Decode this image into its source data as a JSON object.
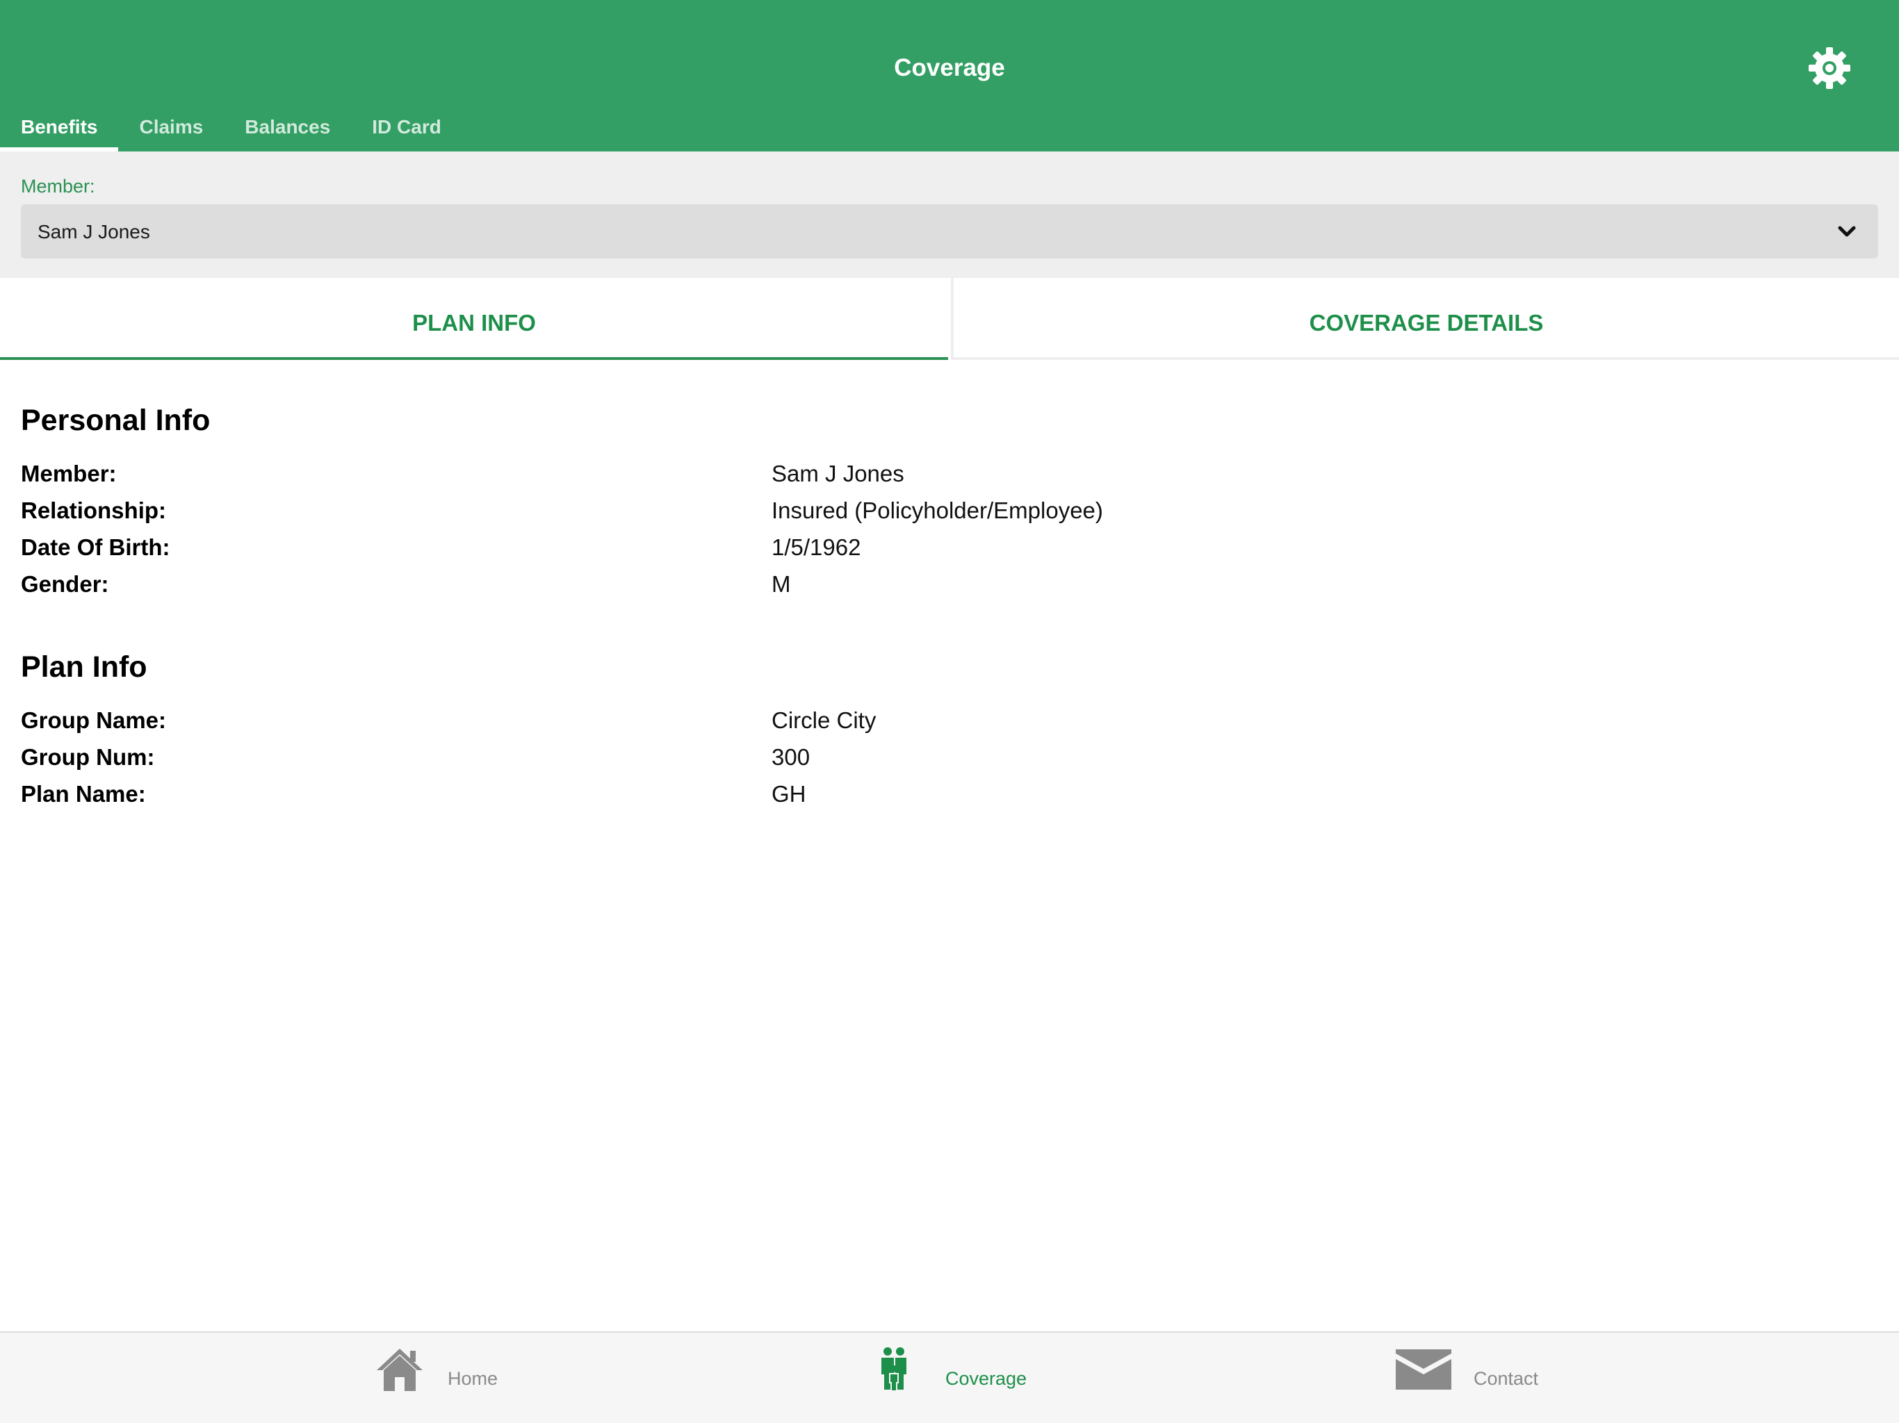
{
  "header": {
    "title": "Coverage",
    "settings_icon": "gear-icon",
    "tabs": [
      {
        "label": "Benefits",
        "active": true
      },
      {
        "label": "Claims",
        "active": false
      },
      {
        "label": "Balances",
        "active": false
      },
      {
        "label": "ID Card",
        "active": false
      }
    ]
  },
  "member_select": {
    "label": "Member:",
    "value": "Sam J Jones",
    "icon": "chevron-down-icon"
  },
  "segments": [
    {
      "label": "PLAN INFO",
      "active": true
    },
    {
      "label": "COVERAGE DETAILS",
      "active": false
    }
  ],
  "personal_info": {
    "title": "Personal Info",
    "rows": [
      {
        "label": "Member:",
        "value": "Sam J Jones"
      },
      {
        "label": "Relationship:",
        "value": "Insured (Policyholder/Employee)"
      },
      {
        "label": "Date Of Birth:",
        "value": "1/5/1962"
      },
      {
        "label": "Gender:",
        "value": "M"
      }
    ]
  },
  "plan_info": {
    "title": "Plan Info",
    "rows": [
      {
        "label": "Group Name:",
        "value": "Circle City"
      },
      {
        "label": "Group Num:",
        "value": "300"
      },
      {
        "label": "Plan Name:",
        "value": "GH"
      }
    ]
  },
  "bottom_nav": [
    {
      "label": "Home",
      "icon": "home-icon",
      "active": false
    },
    {
      "label": "Coverage",
      "icon": "family-icon",
      "active": true
    },
    {
      "label": "Contact",
      "icon": "envelope-icon",
      "active": false
    }
  ],
  "colors": {
    "brand_green": "#339f64",
    "accent_green": "#1e8f4a",
    "inactive_gray": "#8a8a8a"
  }
}
